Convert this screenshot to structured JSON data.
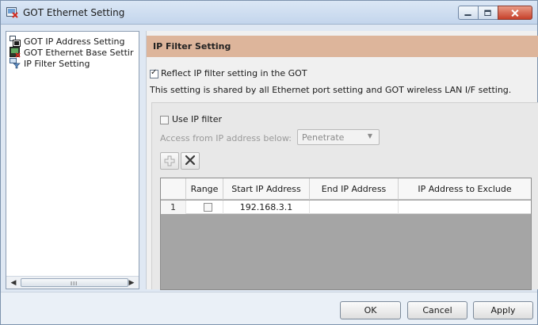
{
  "window": {
    "title": "GOT Ethernet Setting",
    "buttons": [
      "minimize-icon",
      "maximize-icon",
      "close-icon"
    ]
  },
  "tree": {
    "items": [
      {
        "label": "GOT IP Address Setting",
        "icon": "network-settings-icon"
      },
      {
        "label": "GOT Ethernet Base Settir",
        "icon": "ethernet-base-icon"
      },
      {
        "label": "IP Filter Setting",
        "icon": "filter-icon"
      }
    ],
    "scroll_grip": "III"
  },
  "section": {
    "title": "IP Filter Setting"
  },
  "reflect": {
    "label": "Reflect IP filter setting in the GOT",
    "checked": true
  },
  "shared_note": "This setting is shared by all Ethernet port setting and GOT wireless LAN I/F setting.",
  "filter": {
    "use_label": "Use IP filter",
    "use_checked": false,
    "access_label": "Access from IP address below:",
    "access_value": "Penetrate"
  },
  "toolbar": {
    "add_icon": "add-icon",
    "delete_icon": "delete-icon"
  },
  "table": {
    "headers": [
      "",
      "Range",
      "Start IP Address",
      "End IP Address",
      "IP Address to Exclude"
    ],
    "rows": [
      {
        "num": "1",
        "range": false,
        "start": "192.168.3.1",
        "end": "",
        "exclude": ""
      }
    ]
  },
  "buttons": {
    "ok": "OK",
    "cancel": "Cancel",
    "apply": "Apply"
  },
  "colors": {
    "section_header": "#ddb59b",
    "title_bar": "#c3d5ec",
    "close_button": "#c6402a"
  }
}
